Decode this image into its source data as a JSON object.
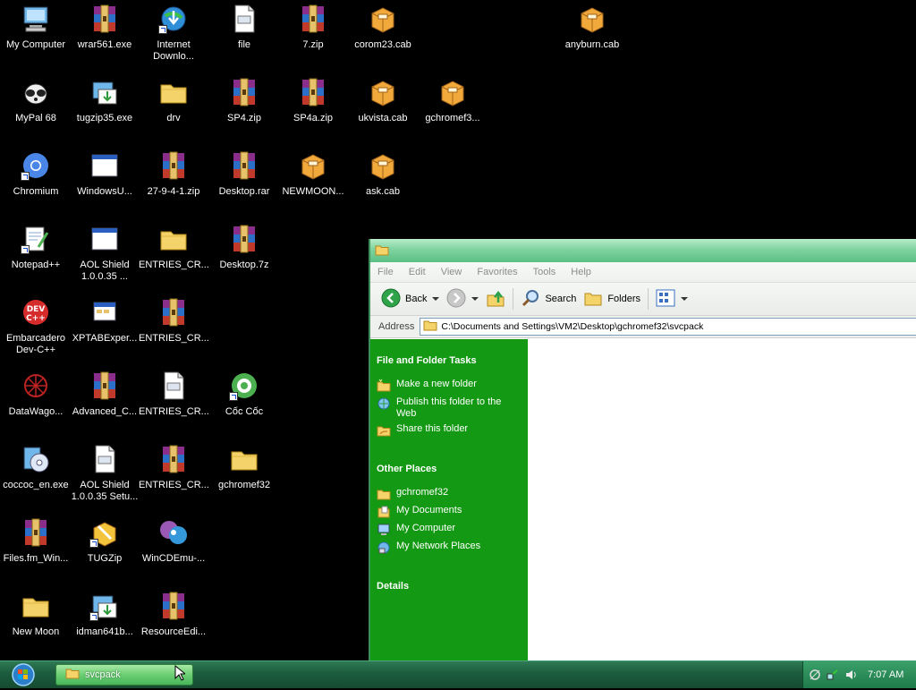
{
  "desktop": {
    "icons": [
      {
        "label": "My Computer",
        "icon": "my-computer-icon"
      },
      {
        "label": "wrar561.exe",
        "icon": "winrar-icon"
      },
      {
        "label": "Internet\nDownlo...",
        "icon": "internet-download-icon"
      },
      {
        "label": "file",
        "icon": "document-icon"
      },
      {
        "label": "7.zip",
        "icon": "winrar-icon"
      },
      {
        "label": "corom23.cab",
        "icon": "cab-icon"
      },
      {
        "label": "anyburn.cab",
        "icon": "cab-icon"
      },
      {
        "label": "MyPal 68",
        "icon": "mypal-icon"
      },
      {
        "label": "tugzip35.exe",
        "icon": "installer-icon"
      },
      {
        "label": "drv",
        "icon": "folder-icon"
      },
      {
        "label": "SP4.zip",
        "icon": "winrar-icon"
      },
      {
        "label": "SP4a.zip",
        "icon": "winrar-icon"
      },
      {
        "label": "ukvista.cab",
        "icon": "cab-icon"
      },
      {
        "label": "gchromef3...",
        "icon": "cab-icon"
      },
      {
        "label": "Chromium",
        "icon": "chromium-icon"
      },
      {
        "label": "WindowsU...",
        "icon": "window-icon"
      },
      {
        "label": "27-9-4-1.zip",
        "icon": "winrar-icon"
      },
      {
        "label": "Desktop.rar",
        "icon": "winrar-icon"
      },
      {
        "label": "NEWMOON...",
        "icon": "cab-icon"
      },
      {
        "label": "ask.cab",
        "icon": "cab-icon"
      },
      {
        "label": "Notepad++",
        "icon": "notepad-plus-icon"
      },
      {
        "label": "AOL Shield\n1.0.0.35 ...",
        "icon": "window-icon"
      },
      {
        "label": "ENTRIES_CR...",
        "icon": "folder-icon"
      },
      {
        "label": "Desktop.7z",
        "icon": "winrar-icon"
      },
      {
        "label": "Embarcadero\nDev-C++",
        "icon": "devcpp-icon"
      },
      {
        "label": "XPTABExper...",
        "icon": "xptab-icon"
      },
      {
        "label": "ENTRIES_CR...",
        "icon": "winrar-icon"
      },
      {
        "label": "DataWago...",
        "icon": "datawagon-icon"
      },
      {
        "label": "Advanced_C...",
        "icon": "winrar-icon"
      },
      {
        "label": "ENTRIES_CR...",
        "icon": "document-icon"
      },
      {
        "label": "Cốc Cốc",
        "icon": "coccoc-icon"
      },
      {
        "label": "coccoc_en.exe",
        "icon": "setup-disc-icon"
      },
      {
        "label": "AOL Shield\n1.0.0.35 Setu...",
        "icon": "document-icon"
      },
      {
        "label": "ENTRIES_CR...",
        "icon": "winrar-icon"
      },
      {
        "label": "gchromef32",
        "icon": "folder-icon"
      },
      {
        "label": "Files.fm_Win...",
        "icon": "winrar-icon"
      },
      {
        "label": "TUGZip",
        "icon": "tugzip-icon"
      },
      {
        "label": "WinCDEmu-...",
        "icon": "wincdemu-icon"
      },
      {
        "label": "New Moon",
        "icon": "folder-icon"
      },
      {
        "label": "idman641b...",
        "icon": "installer-icon"
      },
      {
        "label": "ResourceEdi...",
        "icon": "winrar-icon"
      }
    ]
  },
  "explorer": {
    "menu": [
      "File",
      "Edit",
      "View",
      "Favorites",
      "Tools",
      "Help"
    ],
    "toolbar": {
      "back": "Back",
      "search": "Search",
      "folders": "Folders"
    },
    "address": {
      "label": "Address",
      "path": "C:\\Documents and Settings\\VM2\\Desktop\\gchromef32\\svcpack"
    },
    "tasks": {
      "title": "File and Folder Tasks",
      "items": [
        "Make a new folder",
        "Publish this folder to the Web",
        "Share this folder"
      ]
    },
    "other_places": {
      "title": "Other Places",
      "items": [
        "gchromef32",
        "My Documents",
        "My Computer",
        "My Network Places"
      ]
    },
    "details": {
      "title": "Details"
    }
  },
  "taskbar": {
    "task_label": "svcpack",
    "clock": "7:07 AM"
  },
  "colors": {
    "desktop": "#000000",
    "task_pane": "#139913",
    "taskbar": "#1d5e3f",
    "titlebar": "#7fd3a0"
  }
}
